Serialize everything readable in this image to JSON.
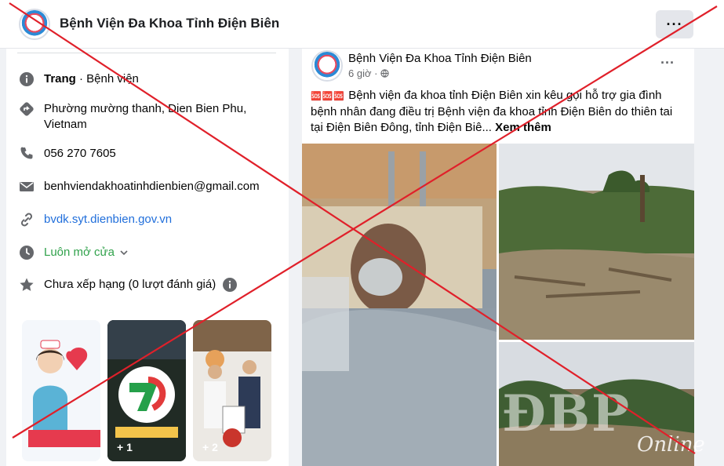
{
  "header": {
    "page_name": "Bệnh Viện Đa Khoa Tỉnh Điện Biên",
    "more_label": "···"
  },
  "intro": {
    "category_label": "Trang",
    "category_value": " · Bệnh viện",
    "address": "Phường mường thanh, Dien Bien Phu, Vietnam",
    "phone": "056 270 7605",
    "email": "benhviendakhoatinhdienbien@gmail.com",
    "website": "bvdk.syt.dienbien.gov.vn",
    "hours": "Luôn mở cửa",
    "rating": "Chưa xếp hạng (0 lượt đánh giá)"
  },
  "thumbs": [
    {
      "plus": ""
    },
    {
      "plus": "+ 1"
    },
    {
      "plus": "+ 2"
    }
  ],
  "post": {
    "author": "Bệnh Viện Đa Khoa Tỉnh Điện Biên",
    "time": "6 giờ · ",
    "emoji": "🆘🆘🆘",
    "text": " Bệnh viện đa khoa tỉnh Điện Biên xin kêu gọi hỗ trợ gia đình bệnh nhân đang điều trị Bệnh viện đa khoa tỉnh Điện Biên do thiên tai tại Điện Biên Đông, tỉnh Điện Biê... ",
    "see_more": "Xem thêm",
    "more_label": "···"
  },
  "watermark": {
    "main": "ĐBP",
    "sub": "Online"
  },
  "colors": {
    "link": "#216fdb",
    "open": "#31a24c",
    "cross": "#e0202a"
  }
}
